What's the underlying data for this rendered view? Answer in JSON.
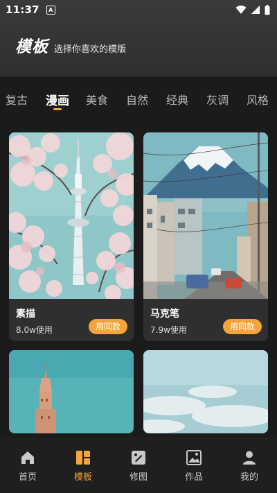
{
  "status": {
    "time": "11:37",
    "notif_glyph": "A"
  },
  "header": {
    "title": "模板",
    "subtitle": "选择你喜欢的模版"
  },
  "tabs": [
    {
      "label": "复古"
    },
    {
      "label": "漫画"
    },
    {
      "label": "美食"
    },
    {
      "label": "自然"
    },
    {
      "label": "经典"
    },
    {
      "label": "灰调"
    },
    {
      "label": "风格"
    }
  ],
  "active_tab": "漫画",
  "cards": [
    {
      "name": "素描",
      "uses": "8.0w使用",
      "button": "用同款",
      "image": "sakura-tower-photo"
    },
    {
      "name": "马克笔",
      "uses": "7.9w使用",
      "button": "用同款",
      "image": "mount-fuji-street-photo"
    },
    {
      "image": "tower-sky-photo"
    },
    {
      "image": "cloud-sky-photo"
    }
  ],
  "nav": [
    {
      "label": "首页",
      "icon": "home-icon"
    },
    {
      "label": "模板",
      "icon": "template-icon"
    },
    {
      "label": "修图",
      "icon": "edit-photo-icon"
    },
    {
      "label": "作品",
      "icon": "gallery-icon"
    },
    {
      "label": "我的",
      "icon": "profile-icon"
    }
  ],
  "colors": {
    "accent": "#f4a23a",
    "panel": "#1b1b1b",
    "card": "#2f2f2f"
  }
}
